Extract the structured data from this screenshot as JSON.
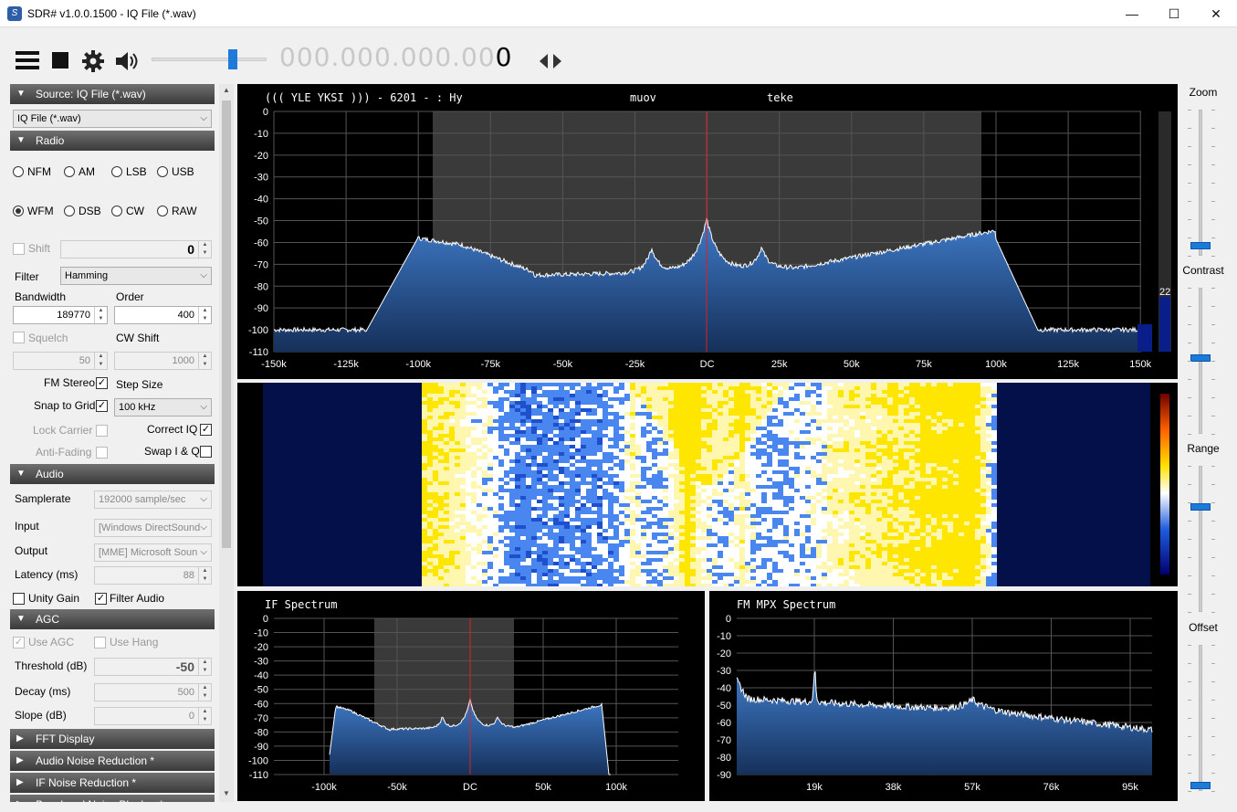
{
  "window": {
    "title": "SDR# v1.0.0.1500 - IQ File (*.wav)",
    "minimize": "—",
    "maximize": "☐",
    "close": "✕"
  },
  "toolbar": {
    "frequency_dim": "000.000.000.00",
    "frequency_last": "0",
    "volume_level": 0.72
  },
  "source": {
    "header": "Source: IQ File (*.wav)",
    "selected": "IQ File (*.wav)"
  },
  "radio": {
    "header": "Radio",
    "modes_row1": [
      "NFM",
      "AM",
      "LSB",
      "USB"
    ],
    "modes_row2": [
      "WFM",
      "DSB",
      "CW",
      "RAW"
    ],
    "selected_mode": "WFM",
    "shift_label": "Shift",
    "shift_value": "0",
    "filter_label": "Filter",
    "filter_value": "Hamming",
    "bandwidth_label": "Bandwidth",
    "bandwidth_value": "189770",
    "order_label": "Order",
    "order_value": "400",
    "squelch_label": "Squelch",
    "squelch_value": "50",
    "cwshift_label": "CW Shift",
    "cwshift_value": "1000",
    "fmstereo_label": "FM Stereo",
    "stepsize_label": "Step Size",
    "snap_label": "Snap to Grid",
    "step_value": "100 kHz",
    "lockcarrier_label": "Lock Carrier",
    "correctiq_label": "Correct IQ",
    "antifading_label": "Anti-Fading",
    "swapiq_label": "Swap I & Q"
  },
  "audio": {
    "header": "Audio",
    "samplerate_label": "Samplerate",
    "samplerate_value": "192000 sample/sec",
    "input_label": "Input",
    "input_value": "[Windows DirectSound",
    "output_label": "Output",
    "output_value": "[MME] Microsoft Soun",
    "latency_label": "Latency (ms)",
    "latency_value": "88",
    "unity_label": "Unity Gain",
    "filter_label": "Filter Audio"
  },
  "agc": {
    "header": "AGC",
    "useagc_label": "Use AGC",
    "usehang_label": "Use Hang",
    "threshold_label": "Threshold (dB)",
    "threshold_value": "-50",
    "decay_label": "Decay (ms)",
    "decay_value": "500",
    "slope_label": "Slope (dB)",
    "slope_value": "0"
  },
  "collapsed": [
    "FFT Display",
    "Audio Noise Reduction *",
    "IF Noise Reduction *",
    "Baseband Noise Blanker *"
  ],
  "spectrum": {
    "rds": "((( YLE YKSI ))) - 6201 - : Hy",
    "rds_mid": "muov",
    "rds_right": "teke",
    "y_ticks": [
      "0",
      "-10",
      "-20",
      "-30",
      "-40",
      "-50",
      "-60",
      "-70",
      "-80",
      "-90",
      "-100",
      "-110"
    ],
    "x_ticks": [
      "-150k",
      "-125k",
      "-100k",
      "-75k",
      "-50k",
      "-25k",
      "DC",
      "25k",
      "50k",
      "75k",
      "100k",
      "125k",
      "150k"
    ],
    "snr": "22"
  },
  "if_spectrum": {
    "title": "IF Spectrum",
    "y_ticks": [
      "0",
      "-10",
      "-20",
      "-30",
      "-40",
      "-50",
      "-60",
      "-70",
      "-80",
      "-90",
      "-100",
      "-110"
    ],
    "x_ticks": [
      "-100k",
      "-50k",
      "DC",
      "50k",
      "100k"
    ]
  },
  "mpx_spectrum": {
    "title": "FM MPX Spectrum",
    "y_ticks": [
      "0",
      "-10",
      "-20",
      "-30",
      "-40",
      "-50",
      "-60",
      "-70",
      "-80",
      "-90"
    ],
    "x_ticks": [
      "19k",
      "38k",
      "57k",
      "76k",
      "95k"
    ]
  },
  "side": {
    "zoom": "Zoom",
    "contrast": "Contrast",
    "range": "Range",
    "offset": "Offset"
  },
  "colors": {
    "accent": "#1e7ad8",
    "spectrum_fill": "#2a5fa8",
    "carrier_line": "#e02020"
  }
}
